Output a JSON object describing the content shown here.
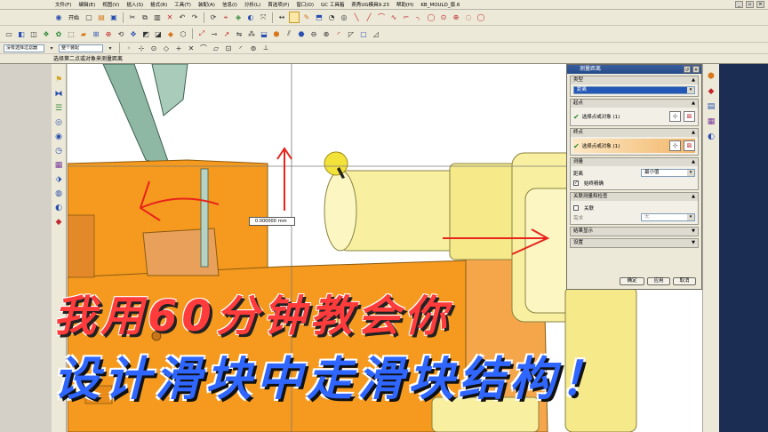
{
  "menubar": {
    "items": [
      "文件(F)",
      "编辑(E)",
      "视图(V)",
      "插入(S)",
      "格式(R)",
      "工具(T)",
      "装配(A)",
      "信息(I)",
      "分析(L)",
      "首选项(P)",
      "窗口(O)",
      "GC 工具箱",
      "燕秀UG模具9.23",
      "帮助(H)",
      "KB_MOULD_版.6"
    ]
  },
  "toolbar": {
    "start_label": "开始",
    "selection_filter": "没有选择过滤器",
    "assembly_scope": "整个装配"
  },
  "cue_line": "选择第二点或对象来测量距离",
  "coord_readout": {
    "value": "0.000000",
    "unit": "mm"
  },
  "dialog": {
    "title": "测量距离",
    "type_section": "类型",
    "type_value": "距离",
    "start_section": "起点",
    "start_label": "选择点或对象 (1)",
    "end_section": "终点",
    "end_label": "选择点或对象 (1)",
    "measure_section": "测量",
    "distance_label": "距离",
    "distance_value": "最小值",
    "always_accurate": "始终精确",
    "assoc_section": "关联测量和检查",
    "assoc_label": "关联",
    "need_label": "需求",
    "need_value": "无",
    "results_section": "结果显示",
    "settings_section": "设置",
    "ok_button": "确定",
    "apply_button": "应用",
    "cancel_button": "取消"
  },
  "captions": {
    "line1": "我用60分钟教会你",
    "line2": "设计滑块中走滑块结构！"
  },
  "colors": {
    "orange_part": "#f59a1e",
    "yellow_part": "#f8f0a0",
    "teal_part": "#8eb8a4",
    "arrow_red": "#e8231c",
    "caption_red": "#ff3b3b",
    "caption_blue": "#2f66ff"
  }
}
